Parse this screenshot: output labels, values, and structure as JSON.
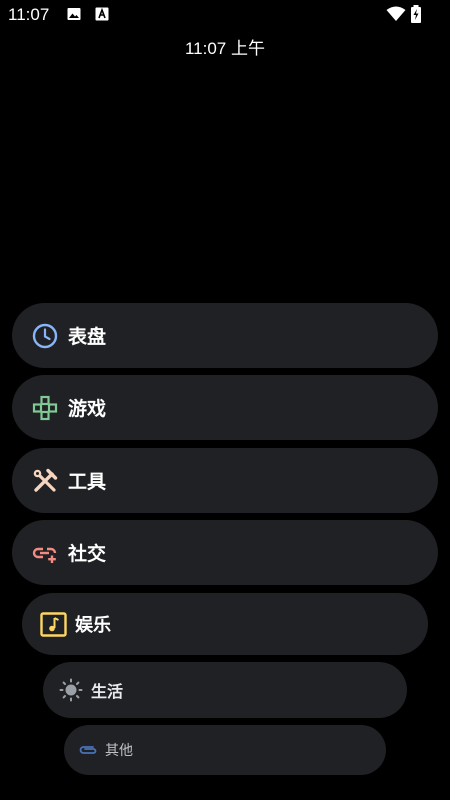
{
  "status_bar": {
    "time": "11:07",
    "icons": [
      "image-icon",
      "font-a-icon",
      "wifi-icon",
      "battery-charging-icon"
    ]
  },
  "clock": {
    "text": "11:07 上午"
  },
  "categories": [
    {
      "label": "表盘",
      "icon": "clock-icon",
      "icon_color": "#8ab4f8"
    },
    {
      "label": "游戏",
      "icon": "gamepad-icon",
      "icon_color": "#81c995"
    },
    {
      "label": "工具",
      "icon": "tools-icon",
      "icon_color": "#f6d5bf"
    },
    {
      "label": "社交",
      "icon": "link-plus-icon",
      "icon_color": "#f28b82"
    },
    {
      "label": "娱乐",
      "icon": "music-note-icon",
      "icon_color": "#fdd663"
    },
    {
      "label": "生活",
      "icon": "sun-icon",
      "icon_color": "#9aa0a6"
    },
    {
      "label": "其他",
      "icon": "paperclip-icon",
      "icon_color": "#4a72b8"
    }
  ]
}
